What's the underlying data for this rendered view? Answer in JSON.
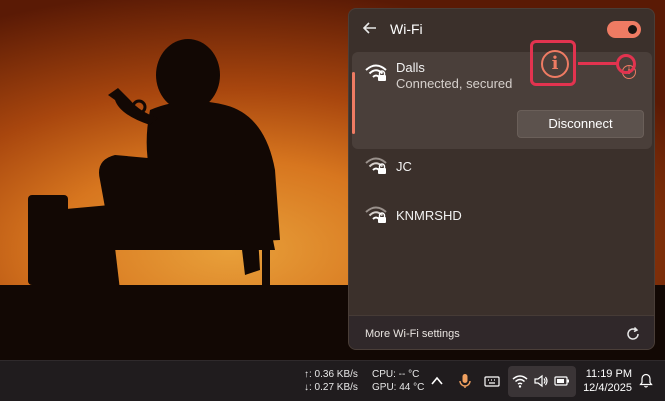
{
  "flyout": {
    "title": "Wi-Fi",
    "wifi_enabled": true,
    "active_network": {
      "name": "Dalls",
      "status": "Connected, secured",
      "disconnect_label": "Disconnect",
      "info_glyph": "i"
    },
    "networks": [
      {
        "name": "JC",
        "secured": true
      },
      {
        "name": "KNMRSHD",
        "secured": true
      }
    ],
    "footer_link": "More Wi-Fi settings"
  },
  "callout": {
    "glyph": "i"
  },
  "taskbar": {
    "upload_speed": "↑: 0.36 KB/s",
    "download_speed": "↓: 0.27 KB/s",
    "cpu_temp": "CPU: -- °C",
    "gpu_temp": "GPU: 44 °C",
    "time": "11:19 PM",
    "date": "12/4/2025",
    "icons": [
      "chevron-up-icon",
      "microphone-icon",
      "keyboard-icon",
      "wifi-icon",
      "volume-icon",
      "battery-icon",
      "notification-icon"
    ]
  },
  "colors": {
    "accent": "#ee7b63",
    "highlight": "#e2334f",
    "flyout_bg": "#3b302b",
    "taskbar_bg": "#201c1e"
  }
}
